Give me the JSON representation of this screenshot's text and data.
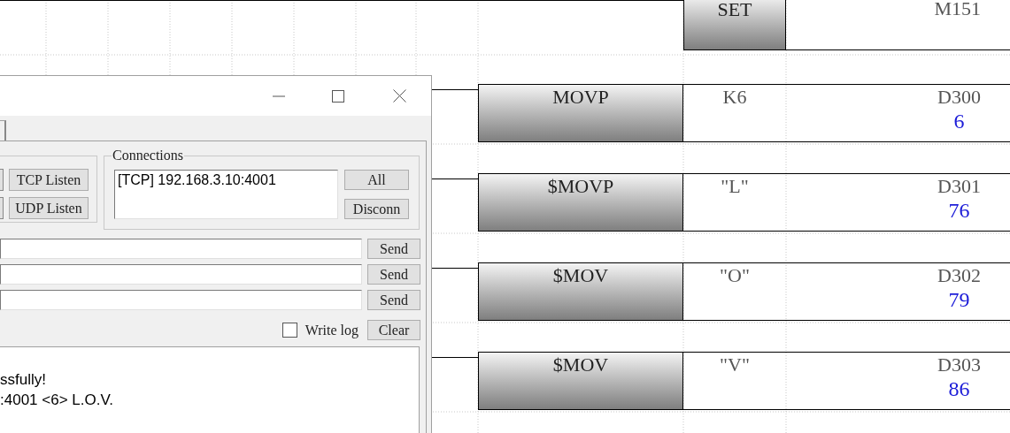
{
  "ladder": {
    "top_rung": {
      "instruction": "SET",
      "operand": "M151"
    },
    "rungs": [
      {
        "instruction": "MOVP",
        "source": "K6",
        "destination": "D300",
        "value": "6"
      },
      {
        "instruction": "$MOVP",
        "source": "\"L\"",
        "destination": "D301",
        "value": "76"
      },
      {
        "instruction": "$MOV",
        "source": "\"O\"",
        "destination": "D302",
        "value": "79"
      },
      {
        "instruction": "$MOV",
        "source": "\"V\"",
        "destination": "D303",
        "value": "86"
      }
    ]
  },
  "dialog": {
    "listen_buttons": [
      "TCP Listen",
      "UDP Listen"
    ],
    "connections": {
      "title": "Connections",
      "items": [
        "[TCP] 192.168.3.10:4001"
      ],
      "buttons": [
        "All",
        "Disconn"
      ]
    },
    "send_buttons": [
      "Send",
      "Send",
      "Send"
    ],
    "write_log": {
      "label": "Write log",
      "checked": false
    },
    "clear_button": "Clear",
    "log_lines": [
      "ssfully!",
      ":4001 <6> L.O.V."
    ]
  }
}
